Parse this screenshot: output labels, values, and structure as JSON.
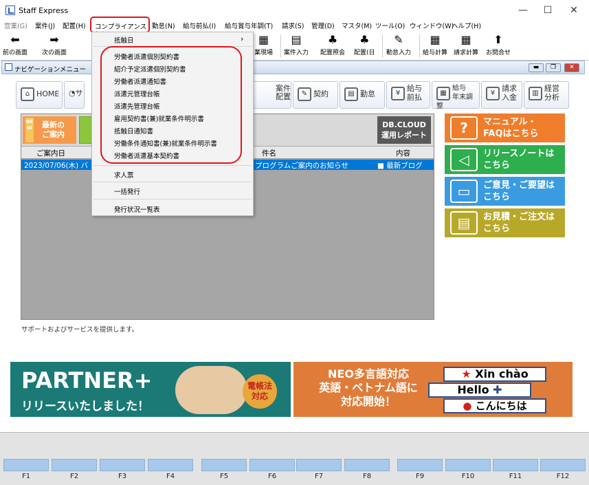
{
  "window": {
    "title": "Staff Express",
    "min": "—",
    "max": "☐",
    "close": "✕"
  },
  "menu": [
    "営業(G)",
    "案件(J)",
    "配置(H)",
    "コンプライアンス(C)",
    "勤怠(N)",
    "給与前払(I)",
    "給与賞与年調(T)",
    "請求(S)",
    "管理(D)",
    "マスタ(M)",
    "ツール(O)",
    "ウィンドウ(W)",
    "ヘルプ(H)"
  ],
  "toolbar": {
    "back": "前の画面",
    "forward": "次の画面",
    "items": [
      "業現場",
      "案件入力",
      "配置照会",
      "配置(日",
      "勤怠入力",
      "給与計算",
      "請求計算",
      "お問合せ"
    ]
  },
  "nav": {
    "title": "ナビゲーションメニュー"
  },
  "navtabs": [
    "HOME",
    "サ",
    "案件\n配置",
    "契約",
    "勤怠",
    "給与\n前払",
    "給与\n年末調整",
    "請求\n入金",
    "経営\n分析"
  ],
  "content": {
    "new_badge": "NEW",
    "new_label": "最新の\nご案内",
    "dbcloud": "DB.CLOUD\n運用レポート",
    "headers": [
      "ご案内日",
      "件名",
      "内容"
    ],
    "row": {
      "date": "2023/07/06(木) バ",
      "subject": "プログラムご案内のお知らせ",
      "content": "■ 最新ブログ"
    },
    "support": "サポートおよびサービスを提供します。"
  },
  "side_buttons": [
    {
      "label": "マニュアル・\nFAQはこちら",
      "color": "#f07d2b",
      "icon": "question-icon"
    },
    {
      "label": "リリースノートは\nこちら",
      "color": "#2eae4e",
      "icon": "megaphone-icon"
    },
    {
      "label": "ご意見・ご要望は\nこちら",
      "color": "#3a9be0",
      "icon": "printer-icon"
    },
    {
      "label": "お見積・ご注文は\nこちら",
      "color": "#b8a82a",
      "icon": "register-icon"
    }
  ],
  "banner_left": {
    "title": "PARTNER+",
    "subtitle": "リリースいたしました！",
    "badge": "電帳法\n対応"
  },
  "banner_right": {
    "title": "NEO多言語対応\n英語・ベトナム語に\n対応開始！",
    "b1": "Xin chào",
    "b2": "Hello",
    "b3": "こんにちは"
  },
  "fkeys": [
    "F1",
    "F2",
    "F3",
    "F4",
    "F5",
    "F6",
    "F7",
    "F8",
    "F9",
    "F10",
    "F11",
    "F12"
  ],
  "dropdown": {
    "top": "抵触日",
    "highlighted": [
      "労働者派遣個別契約書",
      "紹介予定派遣個別契約書",
      "労働者派遣通知書",
      "派遣元管理台帳",
      "派遣先管理台帳",
      "雇用契約書(兼)就業条件明示書",
      "抵触日通知書",
      "労働条件通知書(兼)就業条件明示書",
      "労働者派遣基本契約書"
    ],
    "bottom": [
      "求人票",
      "一括発行",
      "発行状況一覧表"
    ]
  }
}
